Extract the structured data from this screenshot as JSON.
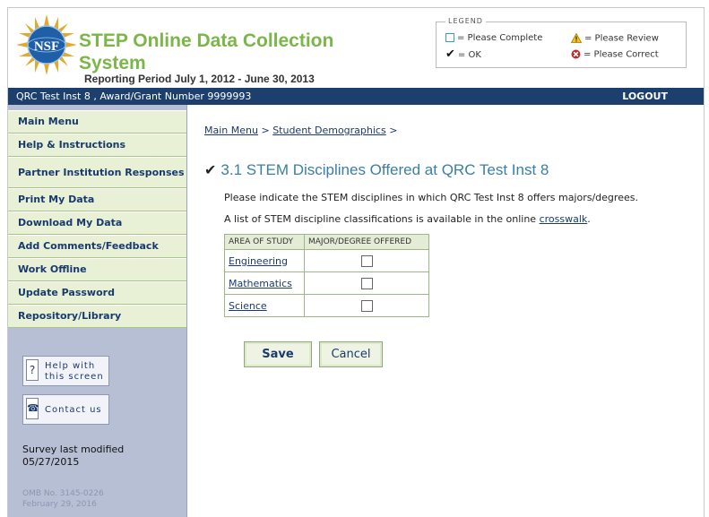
{
  "header": {
    "app_title": "STEP Online Data Collection System",
    "reporting_period": "Reporting Period July 1, 2012 - June 30, 2013",
    "logo_text": "NSF"
  },
  "legend": {
    "title": "LEGEND",
    "complete": "= Please Complete",
    "review": "= Please Review",
    "ok": "= OK",
    "correct": "= Please Correct"
  },
  "bar": {
    "institution": "QRC Test Inst 8 , Award/Grant Number 9999993",
    "logout": "LOGOUT"
  },
  "sidebar": {
    "items": [
      {
        "label": "Main Menu"
      },
      {
        "label": "Help & Instructions"
      },
      {
        "label": "Partner Institution Responses"
      },
      {
        "label": "Print My Data"
      },
      {
        "label": "Download My Data"
      },
      {
        "label": "Add Comments/Feedback"
      },
      {
        "label": "Work Offline"
      },
      {
        "label": "Update Password"
      },
      {
        "label": "Repository/Library"
      }
    ],
    "help_line1": "Help with",
    "help_line2": "this screen",
    "contact": "Contact us",
    "survey_modified_label": "Survey last modified",
    "survey_modified_date": "05/27/2015",
    "omb_number": "OMB No. 3145-0226",
    "omb_date": "February 29, 2016"
  },
  "breadcrumb": {
    "main_menu": "Main Menu",
    "separator": ">",
    "student_demographics": "Student Demographics"
  },
  "section": {
    "title": "3.1 STEM Disciplines Offered at QRC Test Inst 8",
    "instruction": "Please indicate the STEM disciplines in which QRC Test Inst 8 offers majors/degrees.",
    "crosswalk_prefix": "A list of STEM discipline classifications is available in the online",
    "crosswalk_link": "crosswalk",
    "crosswalk_suffix": "."
  },
  "table": {
    "col_area": "AREA OF STUDY",
    "col_major": "MAJOR/DEGREE OFFERED",
    "rows": [
      {
        "area": "Engineering",
        "checked": false
      },
      {
        "area": "Mathematics",
        "checked": false
      },
      {
        "area": "Science",
        "checked": false
      }
    ]
  },
  "actions": {
    "save": "Save",
    "cancel": "Cancel"
  }
}
